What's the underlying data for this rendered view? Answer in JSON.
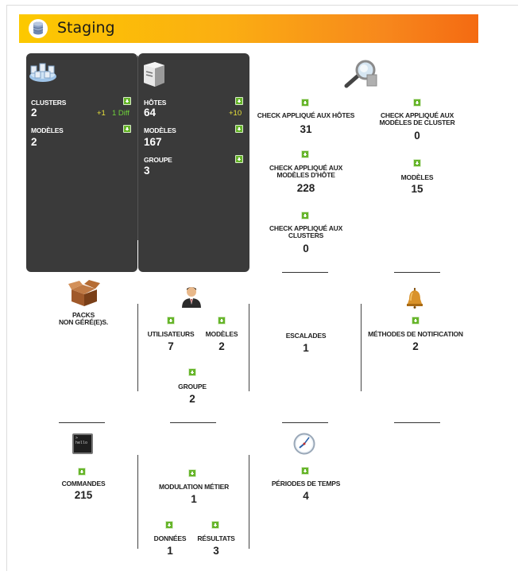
{
  "header": {
    "title": "Staging"
  },
  "clusters_panel": {
    "clusters_label": "CLUSTERS",
    "clusters_value": "2",
    "clusters_delta": "+1",
    "clusters_diff": "1 Diff",
    "models_label": "MODÈLES",
    "models_value": "2"
  },
  "hosts_panel": {
    "hosts_label": "HÔTES",
    "hosts_value": "64",
    "hosts_delta": "+10",
    "models_label": "MODÈLES",
    "models_value": "167",
    "group_label": "GROUPE",
    "group_value": "3"
  },
  "checks": {
    "hosts_label": "CHECK APPLIQUÉ AUX HÔTES",
    "hosts_value": "31",
    "cluster_models_label_1": "CHECK APPLIQUÉ AUX",
    "cluster_models_label_2": "MODÈLES DE CLUSTER",
    "cluster_models_value": "0",
    "host_models_label_1": "CHECK APPLIQUÉ AUX",
    "host_models_label_2": "MODÈLES D'HÔTE",
    "host_models_value": "228",
    "models_label": "MODÈLES",
    "models_value": "15",
    "clusters_label_1": "CHECK APPLIQUÉ AUX",
    "clusters_label_2": "CLUSTERS",
    "clusters_value": "0"
  },
  "packs": {
    "label_1": "PACKS",
    "label_2": "NON GÉRÉ(E)S."
  },
  "users": {
    "users_label": "UTILISATEURS",
    "users_value": "7",
    "models_label": "MODÈLES",
    "models_value": "2",
    "group_label": "GROUPE",
    "group_value": "2"
  },
  "escalations": {
    "label": "ESCALADES",
    "value": "1"
  },
  "notifications": {
    "label": "MÉTHODES DE NOTIFICATION",
    "value": "2"
  },
  "commands": {
    "label": "COMMANDES",
    "value": "215",
    "terminal_text": "> hello"
  },
  "business": {
    "modulation_label": "MODULATION MÉTIER",
    "modulation_value": "1",
    "data_label": "DONNÉES",
    "data_value": "1",
    "results_label": "RÉSULTATS",
    "results_value": "3"
  },
  "timeperiods": {
    "label": "PÉRIODES DE TEMPS",
    "value": "4"
  },
  "colors": {
    "header_start": "#fcc900",
    "header_end": "#f46a12",
    "panel_bg": "#3a3a3a",
    "add_green": "#67b52b"
  }
}
